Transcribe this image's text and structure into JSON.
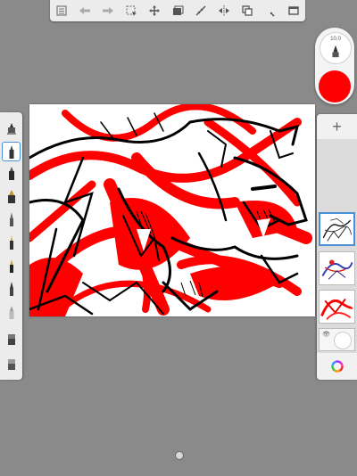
{
  "toolbar": {
    "buttons": [
      {
        "name": "gallery-icon"
      },
      {
        "name": "undo-icon"
      },
      {
        "name": "redo-icon"
      },
      {
        "name": "selection-icon"
      },
      {
        "name": "transform-icon"
      },
      {
        "name": "layer-image-icon"
      },
      {
        "name": "ruler-icon"
      },
      {
        "name": "symmetry-icon"
      },
      {
        "name": "copy-icon"
      },
      {
        "name": "brush-icon"
      },
      {
        "name": "fullscreen-icon"
      }
    ]
  },
  "color_puck": {
    "size_value": "10.0",
    "color": "#ff0000"
  },
  "brushes": [
    "eraser-top",
    "pencil",
    "marker",
    "fat-marker",
    "pen",
    "fine-liner",
    "ink",
    "brush",
    "airbrush",
    "smudge",
    "eraser"
  ],
  "layers": {
    "add_label": "+",
    "background_eye": "👁"
  },
  "colors": {
    "accent": "#4a90d9",
    "brush_color": "#ff0000",
    "background": "#8a8a8a"
  }
}
